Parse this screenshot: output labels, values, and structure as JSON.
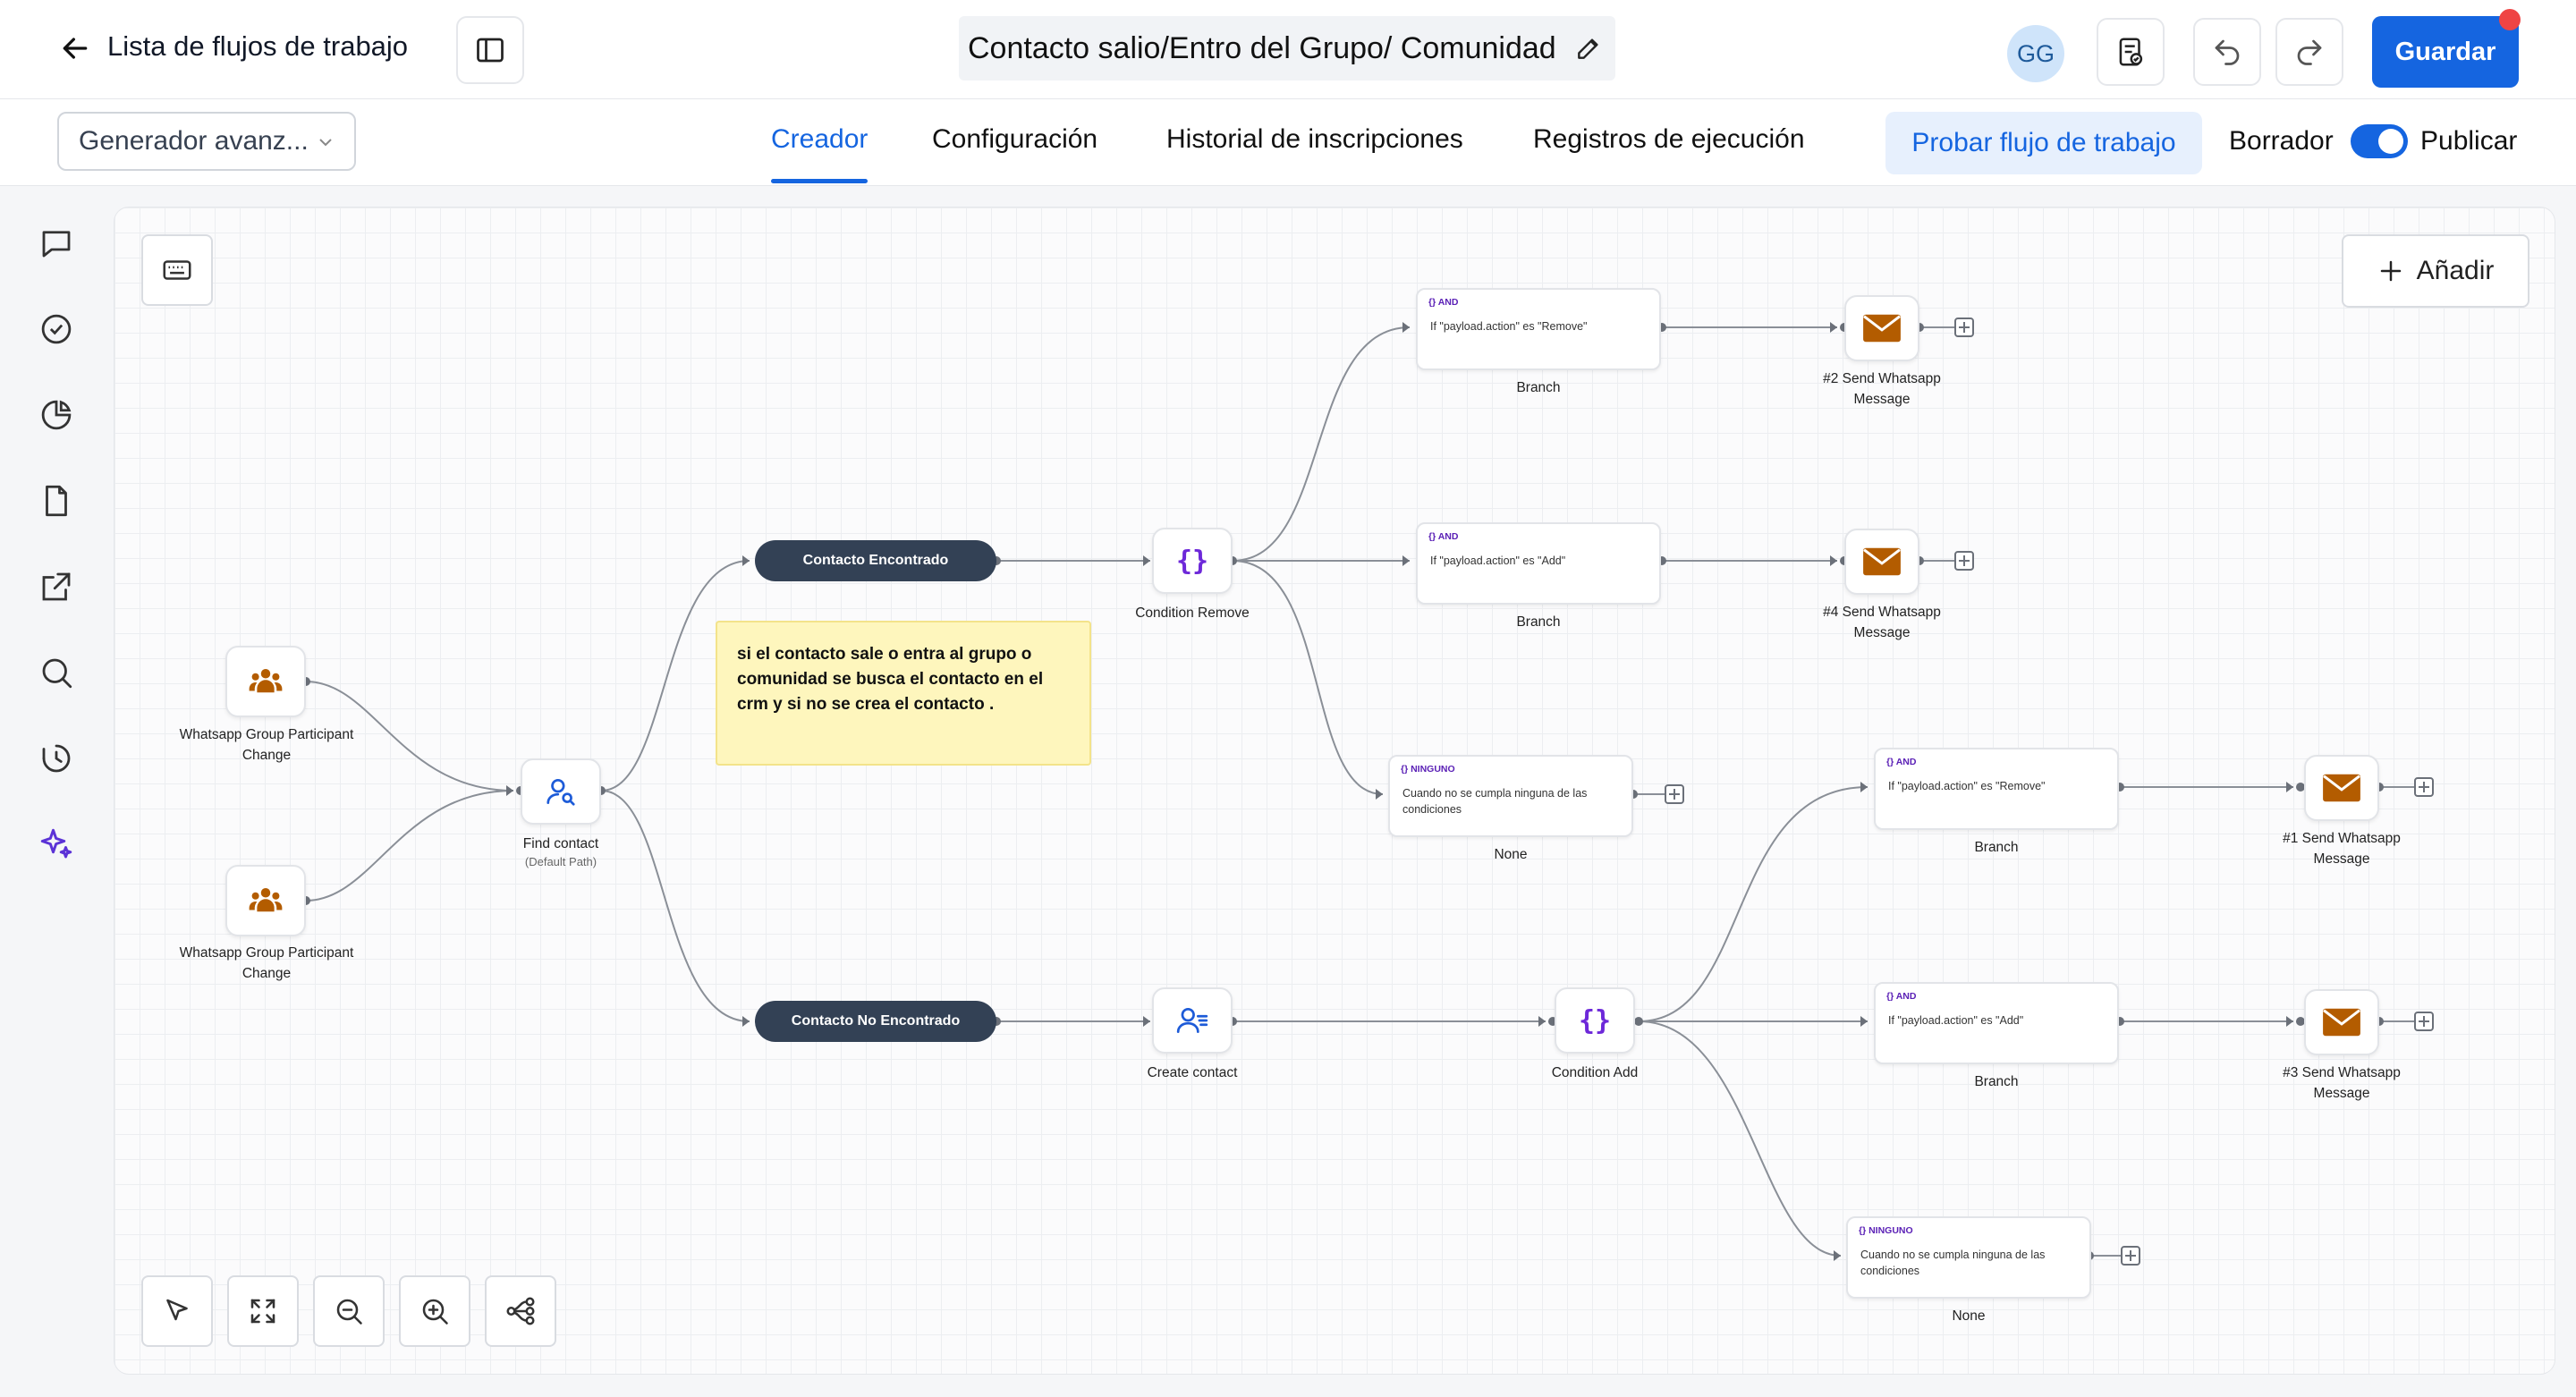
{
  "header": {
    "back_label": "Lista de flujos de trabajo",
    "workflow_name": "Contacto salio/Entro del Grupo/ Comunidad",
    "avatar": "GG",
    "save_label": "Guardar"
  },
  "subbar": {
    "generator_select": "Generador avanz...",
    "tabs": [
      "Creador",
      "Configuración",
      "Historial de inscripciones",
      "Registros de ejecución"
    ],
    "active_tab": "Creador",
    "test_button": "Probar flujo de trabajo",
    "draft_label": "Borrador",
    "publish_label": "Publicar",
    "publish_toggle_on": true
  },
  "canvas": {
    "add_label": "Añadir",
    "triggers": [
      {
        "label": "Whatsapp Group Participant Change"
      },
      {
        "label": "Whatsapp Group Participant Change"
      }
    ],
    "find_contact": {
      "label": "Find contact",
      "sub": "(Default Path)"
    },
    "pills": {
      "found": "Contacto Encontrado",
      "not_found": "Contacto No Encontrado"
    },
    "note": "si el contacto sale o entra al grupo o comunidad se busca el contacto en el crm y si no se crea el contacto .",
    "condition_remove": {
      "label": "Condition Remove"
    },
    "condition_add": {
      "label": "Condition Add"
    },
    "create_contact": {
      "label": "Create contact"
    },
    "branches": [
      {
        "tag": "{} AND",
        "text": "If \"payload.action\" es \"Remove\"",
        "label": "Branch"
      },
      {
        "tag": "{} AND",
        "text": "If \"payload.action\" es \"Add\"",
        "label": "Branch"
      },
      {
        "tag": "{} NINGUNO",
        "text": "Cuando no se cumpla ninguna de las condiciones",
        "label": "None"
      },
      {
        "tag": "{} AND",
        "text": "If \"payload.action\" es \"Remove\"",
        "label": "Branch"
      },
      {
        "tag": "{} AND",
        "text": "If \"payload.action\" es \"Add\"",
        "label": "Branch"
      },
      {
        "tag": "{} NINGUNO",
        "text": "Cuando no se cumpla ninguna de las condiciones",
        "label": "None"
      }
    ],
    "messages": [
      {
        "label_1": "#2 Send Whatsapp",
        "label_2": "Message"
      },
      {
        "label_1": "#4 Send Whatsapp",
        "label_2": "Message"
      },
      {
        "label_1": "#1 Send Whatsapp",
        "label_2": "Message"
      },
      {
        "label_1": "#3 Send Whatsapp",
        "label_2": "Message"
      }
    ]
  },
  "colors": {
    "accent": "#1565e0",
    "pill": "#334155",
    "envelope": "#b35c00",
    "note": "#fef6bd",
    "logic": "#5b21b6"
  }
}
